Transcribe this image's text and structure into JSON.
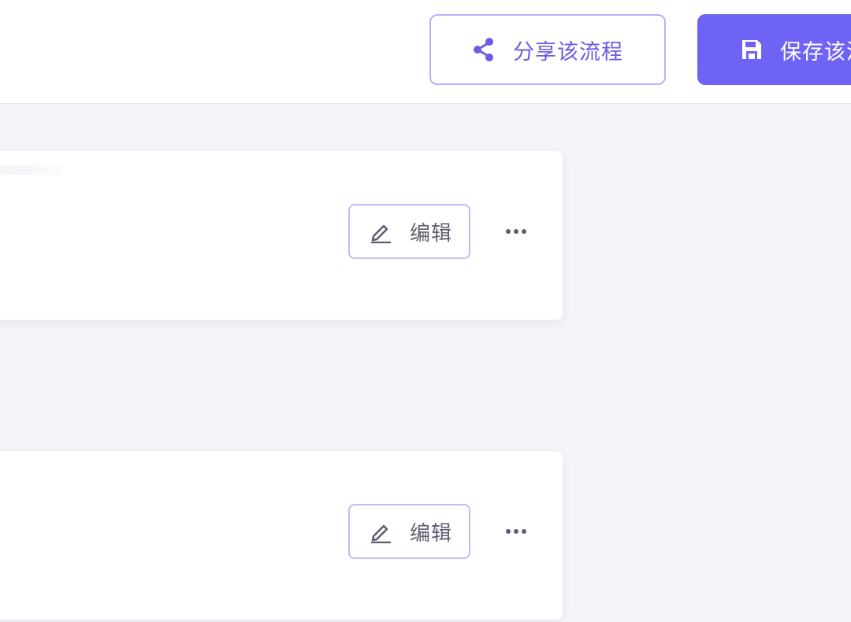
{
  "header": {
    "share_label": "分享该流程",
    "save_label": "保存该流程",
    "share_icon": "share-icon",
    "save_icon": "floppy-disk-icon"
  },
  "cards": [
    {
      "edit_label": "编辑",
      "edit_icon": "pencil-icon",
      "more_icon": "ellipsis-icon"
    },
    {
      "edit_label": "编辑",
      "edit_icon": "pencil-icon",
      "more_icon": "ellipsis-icon"
    }
  ],
  "colors": {
    "accent": "#6f63f5",
    "accent_text": "#6b5ce6",
    "accent_border": "#b9b0f3",
    "background": "#f4f5f9",
    "card": "#ffffff",
    "text_muted": "#5b5f6e"
  }
}
